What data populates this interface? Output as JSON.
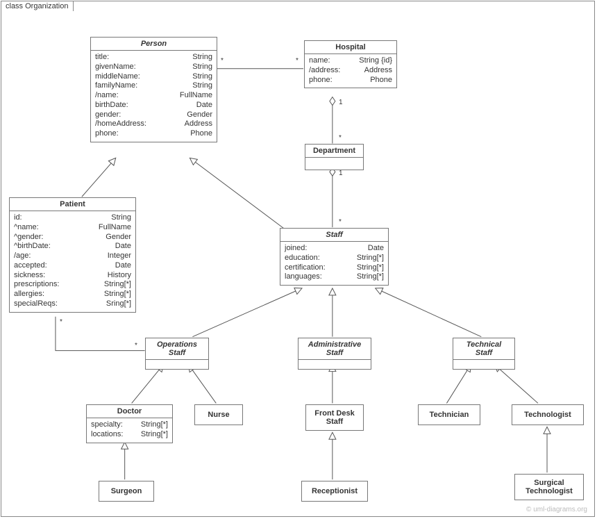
{
  "frame": {
    "label": "class Organization"
  },
  "copyright": "© uml-diagrams.org",
  "classes": {
    "person": {
      "name": "Person",
      "attrs": [
        {
          "n": "title:",
          "t": "String"
        },
        {
          "n": "givenName:",
          "t": "String"
        },
        {
          "n": "middleName:",
          "t": "String"
        },
        {
          "n": "familyName:",
          "t": "String"
        },
        {
          "n": "/name:",
          "t": "FullName"
        },
        {
          "n": "birthDate:",
          "t": "Date"
        },
        {
          "n": "gender:",
          "t": "Gender"
        },
        {
          "n": "/homeAddress:",
          "t": "Address"
        },
        {
          "n": "phone:",
          "t": "Phone"
        }
      ]
    },
    "hospital": {
      "name": "Hospital",
      "attrs": [
        {
          "n": "name:",
          "t": "String {id}"
        },
        {
          "n": "/address:",
          "t": "Address"
        },
        {
          "n": "phone:",
          "t": "Phone"
        }
      ]
    },
    "department": {
      "name": "Department",
      "attrs": []
    },
    "patient": {
      "name": "Patient",
      "attrs": [
        {
          "n": "id:",
          "t": "String"
        },
        {
          "n": "^name:",
          "t": "FullName"
        },
        {
          "n": "^gender:",
          "t": "Gender"
        },
        {
          "n": "^birthDate:",
          "t": "Date"
        },
        {
          "n": "/age:",
          "t": "Integer"
        },
        {
          "n": "accepted:",
          "t": "Date"
        },
        {
          "n": "sickness:",
          "t": "History"
        },
        {
          "n": "prescriptions:",
          "t": "String[*]"
        },
        {
          "n": "allergies:",
          "t": "String[*]"
        },
        {
          "n": "specialReqs:",
          "t": "Sring[*]"
        }
      ]
    },
    "staff": {
      "name": "Staff",
      "attrs": [
        {
          "n": "joined:",
          "t": "Date"
        },
        {
          "n": "education:",
          "t": "String[*]"
        },
        {
          "n": "certification:",
          "t": "String[*]"
        },
        {
          "n": "languages:",
          "t": "String[*]"
        }
      ]
    },
    "opsStaff": {
      "name": "Operations\nStaff"
    },
    "adminStaff": {
      "name": "Administrative\nStaff"
    },
    "techStaff": {
      "name": "Technical\nStaff"
    },
    "doctor": {
      "name": "Doctor",
      "attrs": [
        {
          "n": "specialty:",
          "t": "String[*]"
        },
        {
          "n": "locations:",
          "t": "String[*]"
        }
      ]
    },
    "nurse": {
      "name": "Nurse"
    },
    "frontDesk": {
      "name": "Front Desk\nStaff"
    },
    "technician": {
      "name": "Technician"
    },
    "technologist": {
      "name": "Technologist"
    },
    "surgeon": {
      "name": "Surgeon"
    },
    "receptionist": {
      "name": "Receptionist"
    },
    "surgTech": {
      "name": "Surgical\nTechnologist"
    }
  },
  "multiplicities": {
    "person_hospital_left": "*",
    "person_hospital_right": "*",
    "hospital_dept_top": "1",
    "hospital_dept_bottom": "*",
    "dept_staff_top": "1",
    "dept_staff_bottom": "*",
    "patient_ops_left": "*",
    "patient_ops_right": "*"
  }
}
